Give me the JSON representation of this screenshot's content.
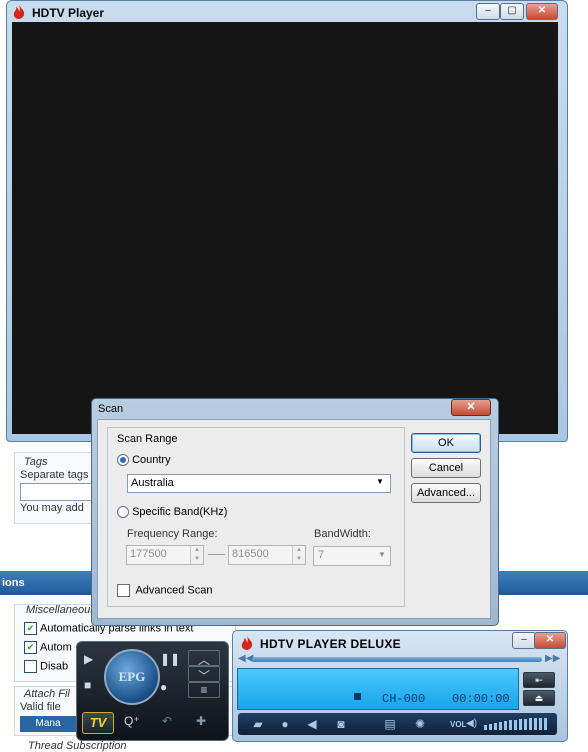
{
  "background_page": {
    "tags": {
      "title": "Tags",
      "description": "Separate tags",
      "note": "You may add"
    },
    "options_bar": {
      "title": "ions"
    },
    "misc_section": {
      "title": "Miscellaneous o",
      "options": [
        {
          "label": "Automatically parse links in text",
          "checked": true
        },
        {
          "label": "Autom",
          "checked": true
        },
        {
          "label": "Disab",
          "checked": false
        }
      ]
    },
    "attach_section": {
      "title": "Attach Fil",
      "valid_label": "Valid file",
      "manage_label": "Mana"
    },
    "thread_subscription": "Thread Subscription"
  },
  "player": {
    "title": "HDTV Player",
    "controls": {
      "minimize": "–",
      "maximize": "▢",
      "close": "✕"
    }
  },
  "scan_dialog": {
    "title": "Scan",
    "close_label": "✕",
    "group_label": "Scan Range",
    "country_label": "Country",
    "country_value": "Australia",
    "specific_band_label": "Specific Band(KHz)",
    "frequency_range_label": "Frequency Range:",
    "freq_from": "177500",
    "freq_to": "816500",
    "bandwidth_label": "BandWidth:",
    "bandwidth_value": "7",
    "advanced_scan_label": "Advanced Scan",
    "selected_mode": "country",
    "advanced_scan_checked": false,
    "buttons": {
      "ok": "OK",
      "cancel": "Cancel",
      "advanced": "Advanced..."
    }
  },
  "deluxe": {
    "title": "HDTV PLAYER DELUXE",
    "channel": "CH-000",
    "time": "00:00:00",
    "epg_label": "EPG",
    "tv_label": "TV",
    "vol_label": "VOL",
    "controls": {
      "minimize": "–",
      "close": "✕"
    }
  }
}
